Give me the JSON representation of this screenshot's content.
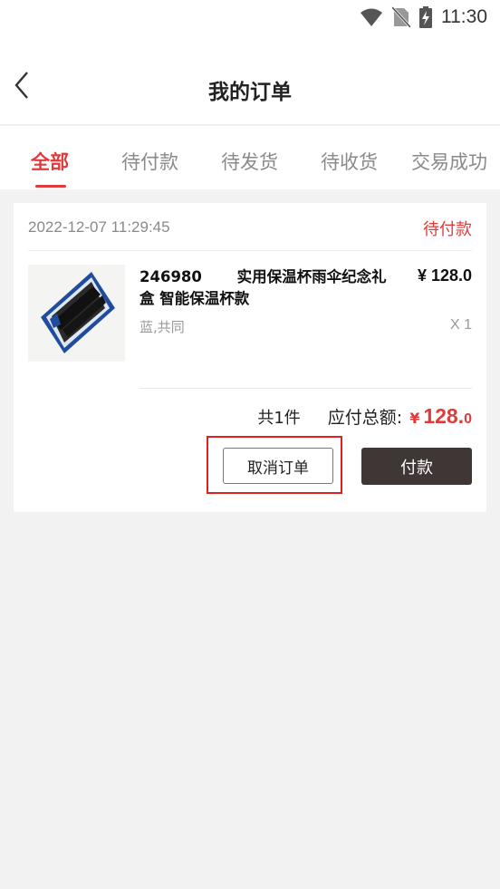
{
  "status_bar": {
    "time": "11:30",
    "icons": [
      "wifi-icon",
      "no-sim-icon",
      "battery-charging-icon"
    ]
  },
  "header": {
    "title": "我的订单",
    "back_icon": "chevron-left-icon"
  },
  "tabs": [
    {
      "label": "全部",
      "active": true
    },
    {
      "label": "待付款",
      "active": false
    },
    {
      "label": "待发货",
      "active": false
    },
    {
      "label": "待收货",
      "active": false
    },
    {
      "label": "交易成功",
      "active": false
    }
  ],
  "order": {
    "datetime": "2022-12-07 11:29:45",
    "status": "待付款",
    "item": {
      "name_line1": "246980 　　实用保温杯雨伞纪念礼",
      "name_line2": "盒 智能保温杯款",
      "price": "¥ 128.0",
      "spec": "蓝,共同",
      "quantity": "X 1"
    },
    "count_text": "共1件",
    "total_label": "应付总额:",
    "currency": "¥",
    "total_int": "128.",
    "total_dec": "0",
    "cancel_label": "取消订单",
    "pay_label": "付款"
  },
  "colors": {
    "accent": "#e13a3a",
    "pay_button": "#3e3735",
    "highlight_box": "#e02020",
    "background": "#f2f2f2"
  }
}
